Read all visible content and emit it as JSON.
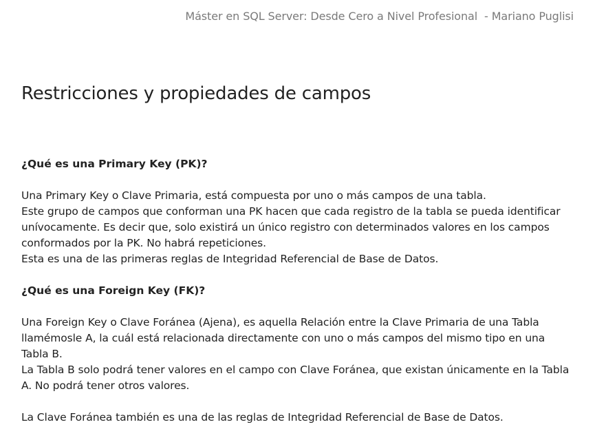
{
  "header": {
    "course_title": "Máster en SQL Server: Desde Cero a Nivel Profesional  - Mariano Puglisi"
  },
  "page": {
    "title": "Restricciones y propiedades de campos"
  },
  "sections": [
    {
      "heading": "¿Qué es una Primary Key (PK)?",
      "lines": [
        "Una Primary Key o Clave Primaria, está compuesta por uno o más campos de una tabla.",
        "Este grupo de campos que conforman una PK hacen que cada registro de la tabla se pueda identificar",
        "unívocamente. Es decir que, solo existirá un único registro con determinados valores en los campos",
        "conformados por la PK. No habrá repeticiones.",
        "Esta es una de las primeras reglas de Integridad Referencial de Base de Datos."
      ]
    },
    {
      "heading": "¿Qué es una Foreign Key (FK)?",
      "lines": [
        "Una Foreign Key o Clave Foránea (Ajena), es aquella Relación entre la Clave Primaria de una Tabla",
        "llamémosle A, la cuál está relacionada directamente con uno o más campos del mismo tipo en una",
        "Tabla B.",
        "La Tabla B solo podrá tener valores en el campo con Clave Foránea, que existan únicamente en la Tabla",
        "A. No podrá tener otros valores."
      ],
      "closing": "La Clave Foránea también es una de las reglas de Integridad Referencial de Base de Datos."
    }
  ]
}
